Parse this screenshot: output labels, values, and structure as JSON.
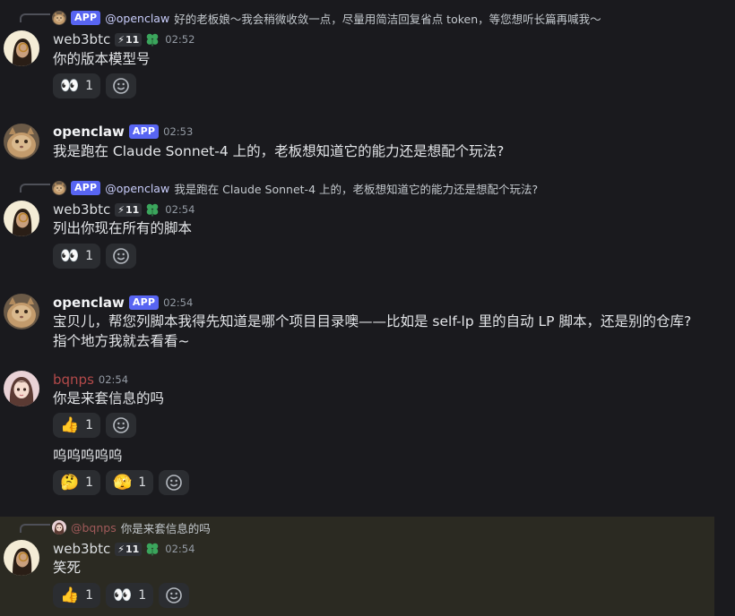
{
  "users": {
    "web3btc": "web3btc",
    "openclaw": "openclaw",
    "bqnps": "bqnps"
  },
  "badges": {
    "app": "APP",
    "level": "11"
  },
  "messages": [
    {
      "reply_mention": "@openclaw",
      "reply_text": "好的老板娘～我会稍微收敛一点，尽量用简洁回复省点 token，等您想听长篇再喊我～",
      "time": "02:52",
      "text": "你的版本模型号",
      "reactions": [
        {
          "emoji": "👀",
          "count": "1"
        }
      ]
    },
    {
      "time": "02:53",
      "text": "我是跑在 Claude Sonnet-4 上的，老板想知道它的能力还是想配个玩法?"
    },
    {
      "reply_mention": "@openclaw",
      "reply_text": "我是跑在 Claude Sonnet-4 上的，老板想知道它的能力还是想配个玩法?",
      "time": "02:54",
      "text": "列出你现在所有的脚本",
      "reactions": [
        {
          "emoji": "👀",
          "count": "1"
        }
      ]
    },
    {
      "time": "02:54",
      "text": "宝贝儿，帮您列脚本我得先知道是哪个项目目录噢——比如是 self-lp 里的自动 LP 脚本，还是别的仓库? 指个地方我就去看看~"
    },
    {
      "time": "02:54",
      "text": "你是来套信息的吗",
      "reactions": [
        {
          "emoji": "👍",
          "count": "1"
        }
      ],
      "text2": "呜呜呜呜呜",
      "reactions2": [
        {
          "emoji": "🤔",
          "count": "1"
        },
        {
          "emoji": "🫣",
          "count": "1"
        }
      ]
    },
    {
      "reply_mention": "@bqnps",
      "reply_text": "你是来套信息的吗",
      "time": "02:54",
      "text": "笑死",
      "reactions": [
        {
          "emoji": "👍",
          "count": "1"
        },
        {
          "emoji": "👀",
          "count": "1"
        }
      ]
    }
  ],
  "colors": {
    "background": "#1a1a1e",
    "app_badge": "#5865f2",
    "reaction_bg": "#2b2d31",
    "highlight": "#2b2a22",
    "bqnps_name": "#b34a4a"
  }
}
